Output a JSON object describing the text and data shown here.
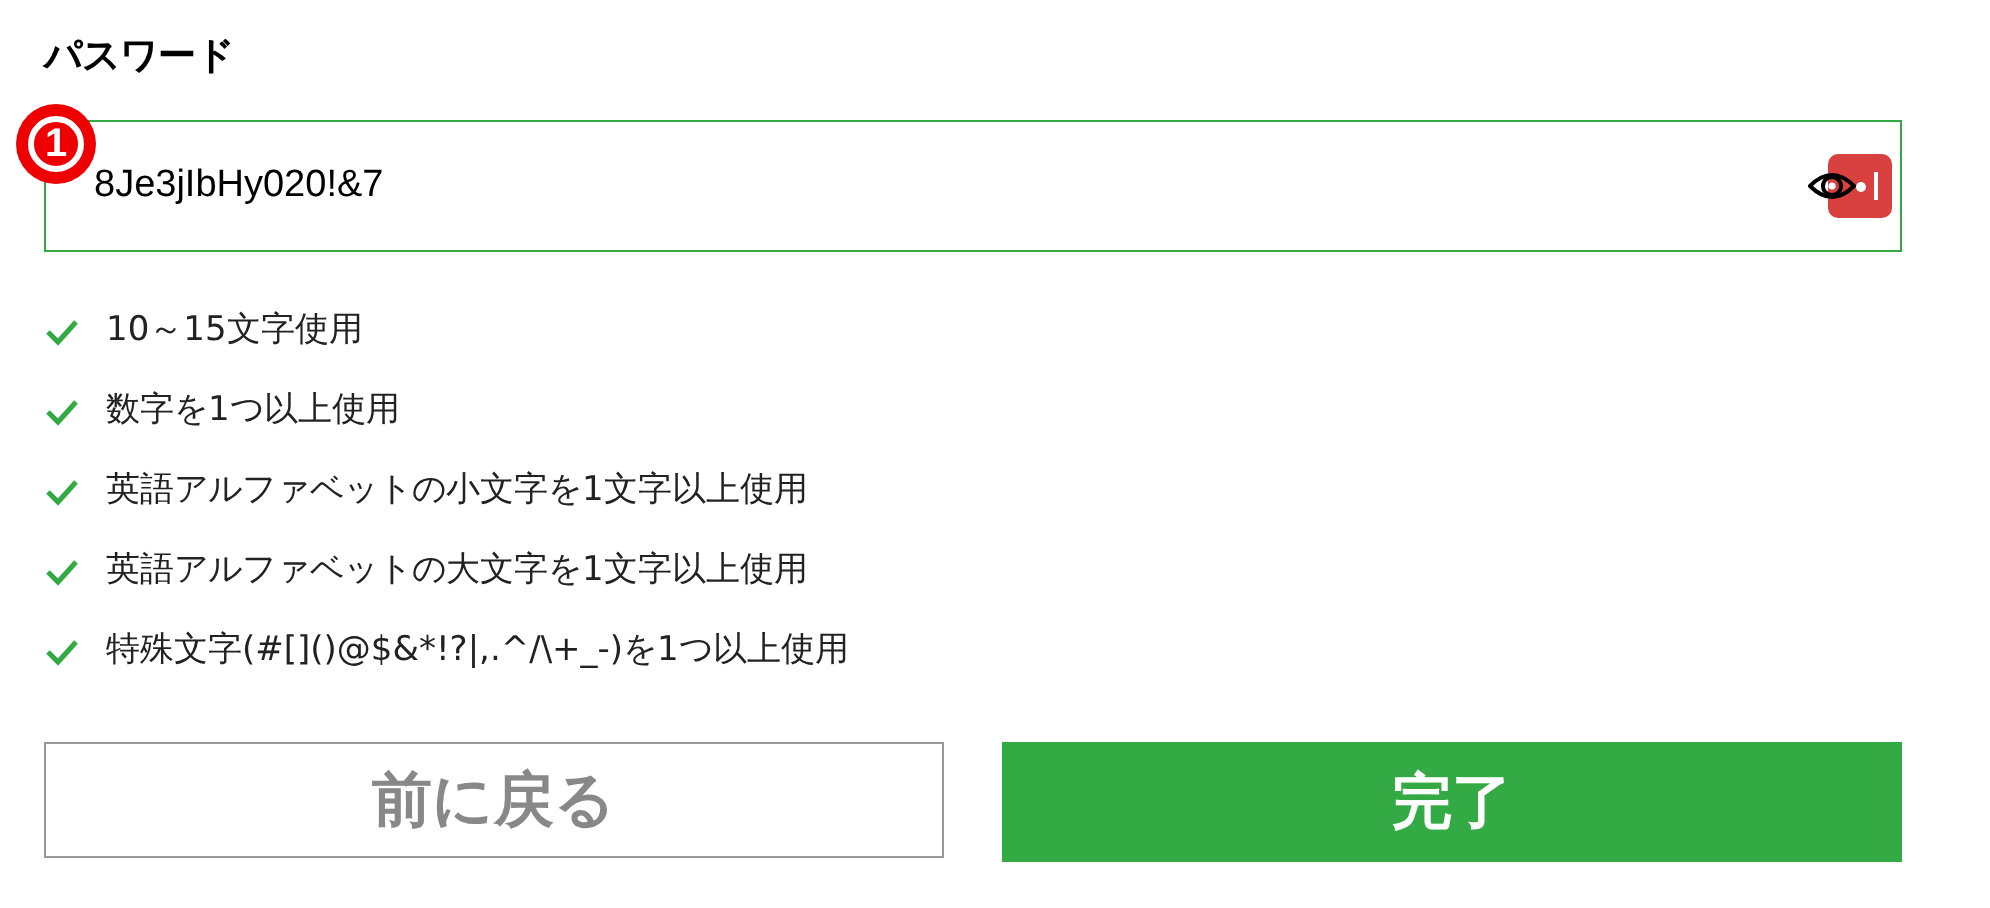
{
  "label": "パスワード",
  "marker": "1",
  "password": {
    "value": "8Je3jIbHy020!&7",
    "focused": true
  },
  "requirements": [
    {
      "text": "10～15文字使用",
      "met": true
    },
    {
      "text": "数字を1つ以上使用",
      "met": true
    },
    {
      "text": "英語アルファベットの小文字を1文字以上使用",
      "met": true
    },
    {
      "text": "英語アルファベットの大文字を1文字以上使用",
      "met": true
    },
    {
      "text": "特殊文字(#[]()@$&*!?|,.^/\\+_-)を1つ以上使用",
      "met": true
    }
  ],
  "buttons": [
    {
      "label": "前に戻る",
      "kind": "secondary"
    },
    {
      "label": "完了",
      "kind": "primary"
    }
  ]
}
